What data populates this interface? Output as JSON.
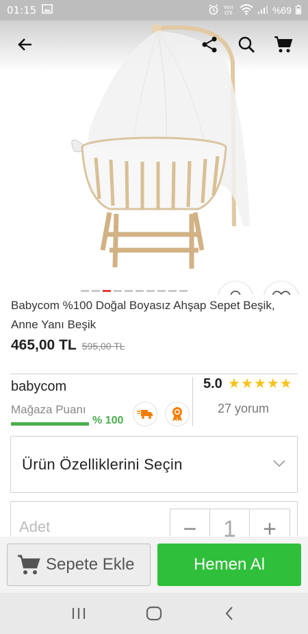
{
  "status_bar": {
    "time": "01:15",
    "battery": "%69",
    "volte": "VoLTE",
    "icons": [
      "image-icon",
      "alarm-icon",
      "volte-icon",
      "wifi-icon",
      "signal-icon",
      "battery-icon"
    ]
  },
  "header": {
    "icons": [
      "back-arrow-icon",
      "share-icon",
      "search-icon",
      "cart-icon"
    ]
  },
  "gallery": {
    "image": "wooden-crib-with-canopy",
    "dot_count": 10,
    "active_dot": 2
  },
  "product": {
    "title": "Babycom %100 Doğal Boyasız Ahşap Sepet Beşik, Anne Yanı Beşik",
    "price": "465,00 TL",
    "old_price": "595,00 TL"
  },
  "store": {
    "name": "babycom",
    "score_label": "Mağaza Puanı",
    "score": "% 100",
    "score_fraction": 1.0,
    "badges": [
      "fast-delivery-truck-icon",
      "award-ribbon-icon"
    ]
  },
  "rating": {
    "value": "5.0",
    "stars": 5,
    "reviews": "27 yorum"
  },
  "options": {
    "label": "Ürün Özelliklerini Seçin"
  },
  "quantity": {
    "label": "Adet",
    "value": "1",
    "minus": "−",
    "plus": "+"
  },
  "actions": {
    "add_to_cart": "Sepete Ekle",
    "buy_now": "Hemen Al"
  },
  "colors": {
    "primary_green": "#2fbf3a",
    "score_green": "#4caf50",
    "star_yellow": "#f9c21b",
    "active_dot": "#e53935",
    "badge_orange": "#f57c00"
  }
}
